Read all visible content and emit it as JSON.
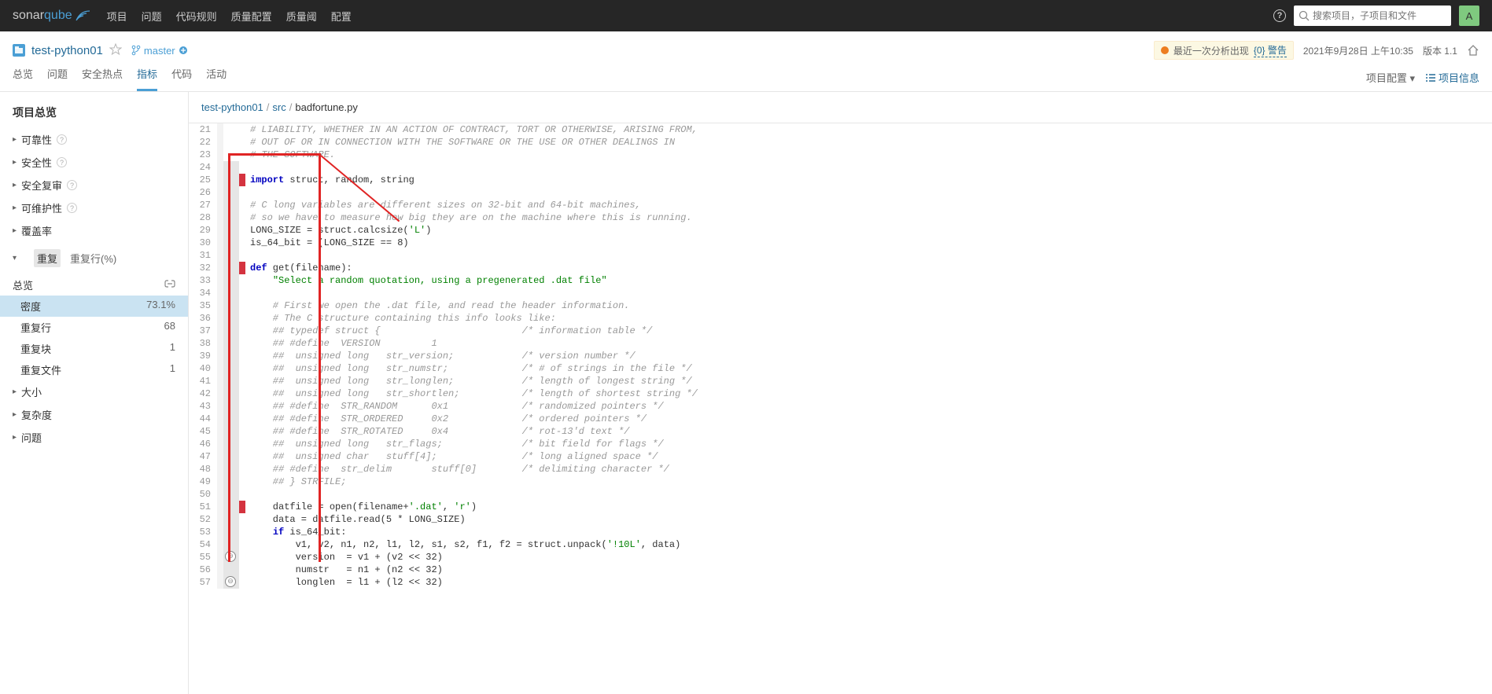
{
  "brand": {
    "sonar": "sonar",
    "qube": "qube"
  },
  "topnav": {
    "links": [
      "项目",
      "问题",
      "代码规则",
      "质量配置",
      "质量阈",
      "配置"
    ]
  },
  "search": {
    "placeholder": "搜索项目，子项目和文件"
  },
  "avatar": "A",
  "project": {
    "name": "test-python01",
    "branch": "master",
    "warning_prefix": "最近一次分析出现",
    "warning_link": "{0} 警告",
    "timestamp": "2021年9月28日 上午10:35",
    "version": "版本 1.1"
  },
  "tabs": {
    "items": [
      "总览",
      "问题",
      "安全热点",
      "指标",
      "代码",
      "活动"
    ],
    "active": 3
  },
  "project_config": "项目配置 ▾",
  "project_info": "项目信息",
  "sidebar": {
    "title": "项目总览",
    "items": [
      {
        "label": "可靠性",
        "q": true
      },
      {
        "label": "安全性",
        "q": true
      },
      {
        "label": "安全复审",
        "q": true
      },
      {
        "label": "可维护性",
        "q": true
      },
      {
        "label": "覆盖率"
      }
    ],
    "dup": {
      "label": "重复",
      "subtabs": [
        "重复行(%)"
      ],
      "overview": "总览",
      "rows": [
        {
          "label": "密度",
          "val": "73.1%",
          "selected": true
        },
        {
          "label": "重复行",
          "val": "68"
        },
        {
          "label": "重复块",
          "val": "1"
        },
        {
          "label": "重复文件",
          "val": "1"
        }
      ]
    },
    "rest": [
      "大小",
      "复杂度",
      "问题"
    ]
  },
  "breadcrumb": {
    "parts": [
      "test-python01",
      "src",
      "badfortune.py"
    ]
  },
  "code": [
    {
      "n": "21",
      "c": "# LIABILITY, WHETHER IN AN ACTION OF CONTRACT, TORT OR OTHERWISE, ARISING FROM,",
      "cm": true
    },
    {
      "n": "22",
      "c": "# OUT OF OR IN CONNECTION WITH THE SOFTWARE OR THE USE OR OTHER DEALINGS IN",
      "cm": true
    },
    {
      "n": "23",
      "c": "# THE SOFTWARE.",
      "cm": true
    },
    {
      "n": "24",
      "c": "",
      "dup": true
    },
    {
      "n": "25",
      "c": "import struct, random, string",
      "kw": "import",
      "dup": true,
      "mark": true
    },
    {
      "n": "26",
      "c": "",
      "dup": true
    },
    {
      "n": "27",
      "c": "# C long variables are different sizes on 32-bit and 64-bit machines,",
      "cm": true,
      "dup": true
    },
    {
      "n": "28",
      "c": "# so we have to measure how big they are on the machine where this is running.",
      "cm": true,
      "dup": true
    },
    {
      "n": "29",
      "c": "LONG_SIZE = struct.calcsize('L')",
      "s": "'L'",
      "dup": true
    },
    {
      "n": "30",
      "c": "is_64_bit = (LONG_SIZE == 8)",
      "dup": true
    },
    {
      "n": "31",
      "c": "",
      "dup": true
    },
    {
      "n": "32",
      "c": "def get(filename):",
      "kw": "def",
      "dup": true,
      "mark": true
    },
    {
      "n": "33",
      "c": "    \"Select a random quotation, using a pregenerated .dat file\"",
      "s": "\"Select a random quotation, using a pregenerated .dat file\"",
      "dup": true
    },
    {
      "n": "34",
      "c": "",
      "dup": true
    },
    {
      "n": "35",
      "c": "    # First we open the .dat file, and read the header information.",
      "cm": true,
      "dup": true
    },
    {
      "n": "36",
      "c": "    # The C structure containing this info looks like:",
      "cm": true,
      "dup": true
    },
    {
      "n": "37",
      "c": "    ## typedef struct {                         /* information table */",
      "cm": true,
      "dup": true
    },
    {
      "n": "38",
      "c": "    ## #define  VERSION         1",
      "cm": true,
      "dup": true
    },
    {
      "n": "39",
      "c": "    ##  unsigned long   str_version;            /* version number */",
      "cm": true,
      "dup": true
    },
    {
      "n": "40",
      "c": "    ##  unsigned long   str_numstr;             /* # of strings in the file */",
      "cm": true,
      "dup": true
    },
    {
      "n": "41",
      "c": "    ##  unsigned long   str_longlen;            /* length of longest string */",
      "cm": true,
      "dup": true
    },
    {
      "n": "42",
      "c": "    ##  unsigned long   str_shortlen;           /* length of shortest string */",
      "cm": true,
      "dup": true
    },
    {
      "n": "43",
      "c": "    ## #define  STR_RANDOM      0x1             /* randomized pointers */",
      "cm": true,
      "dup": true
    },
    {
      "n": "44",
      "c": "    ## #define  STR_ORDERED     0x2             /* ordered pointers */",
      "cm": true,
      "dup": true
    },
    {
      "n": "45",
      "c": "    ## #define  STR_ROTATED     0x4             /* rot-13'd text */",
      "cm": true,
      "dup": true
    },
    {
      "n": "46",
      "c": "    ##  unsigned long   str_flags;              /* bit field for flags */",
      "cm": true,
      "dup": true
    },
    {
      "n": "47",
      "c": "    ##  unsigned char   stuff[4];               /* long aligned space */",
      "cm": true,
      "dup": true
    },
    {
      "n": "48",
      "c": "    ## #define  str_delim       stuff[0]        /* delimiting character */",
      "cm": true,
      "dup": true
    },
    {
      "n": "49",
      "c": "    ## } STRFILE;",
      "cm": true,
      "dup": true
    },
    {
      "n": "50",
      "c": "",
      "dup": true
    },
    {
      "n": "51",
      "c": "    datfile = open(filename+'.dat', 'r')",
      "dup": true,
      "mark": true
    },
    {
      "n": "52",
      "c": "    data = datfile.read(5 * LONG_SIZE)",
      "dup": true
    },
    {
      "n": "53",
      "c": "    if is_64_bit:",
      "kw": "if",
      "dup": true
    },
    {
      "n": "54",
      "c": "        v1, v2, n1, n2, l1, l2, s1, s2, f1, f2 = struct.unpack('!10L', data)",
      "dup": true
    },
    {
      "n": "55",
      "c": "        version  = v1 + (v2 << 32)",
      "dup": true,
      "iss": true
    },
    {
      "n": "56",
      "c": "        numstr   = n1 + (n2 << 32)",
      "dup": true
    },
    {
      "n": "57",
      "c": "        longlen  = l1 + (l2 << 32)",
      "dup": true,
      "iss": true
    }
  ]
}
